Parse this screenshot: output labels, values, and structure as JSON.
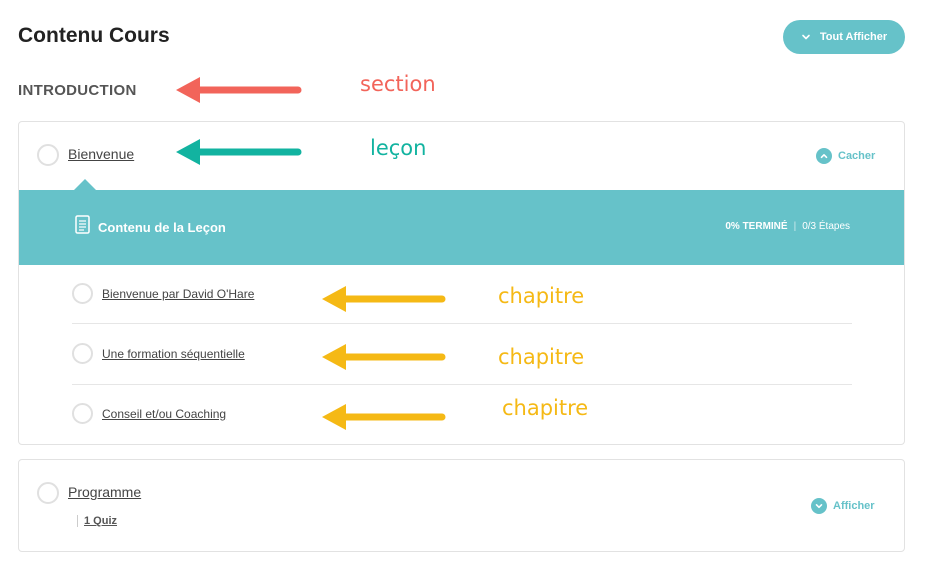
{
  "header": {
    "title": "Contenu Cours",
    "show_all_label": "Tout Afficher"
  },
  "section": {
    "title": "INTRODUCTION"
  },
  "annotations": {
    "section_label": "section",
    "lesson_label": "leçon",
    "topic_label_1": "chapitre",
    "topic_label_2": "chapitre",
    "topic_label_3": "chapitre",
    "colors": {
      "section": "#f2645a",
      "lesson": "#12b3a0",
      "topic": "#f5b915"
    }
  },
  "lessons": [
    {
      "title": "Bienvenue",
      "toggle_label": "Cacher",
      "content": {
        "title": "Contenu de la Leçon",
        "progress_pct": "0% TERMINÉ",
        "separator": "|",
        "steps": "0/3 Étapes"
      },
      "topics": [
        {
          "title": "Bienvenue par David O'Hare"
        },
        {
          "title": "Une formation séquentielle"
        },
        {
          "title": "Conseil et/ou Coaching"
        }
      ]
    },
    {
      "title": "Programme",
      "toggle_label": "Afficher",
      "quiz": "1 Quiz"
    }
  ],
  "colors": {
    "accent": "#66c2c9",
    "border": "#e2e2e2"
  },
  "icons": [
    "chevron-down-icon",
    "chevron-up-icon",
    "document-icon",
    "arrow-left-icon"
  ]
}
